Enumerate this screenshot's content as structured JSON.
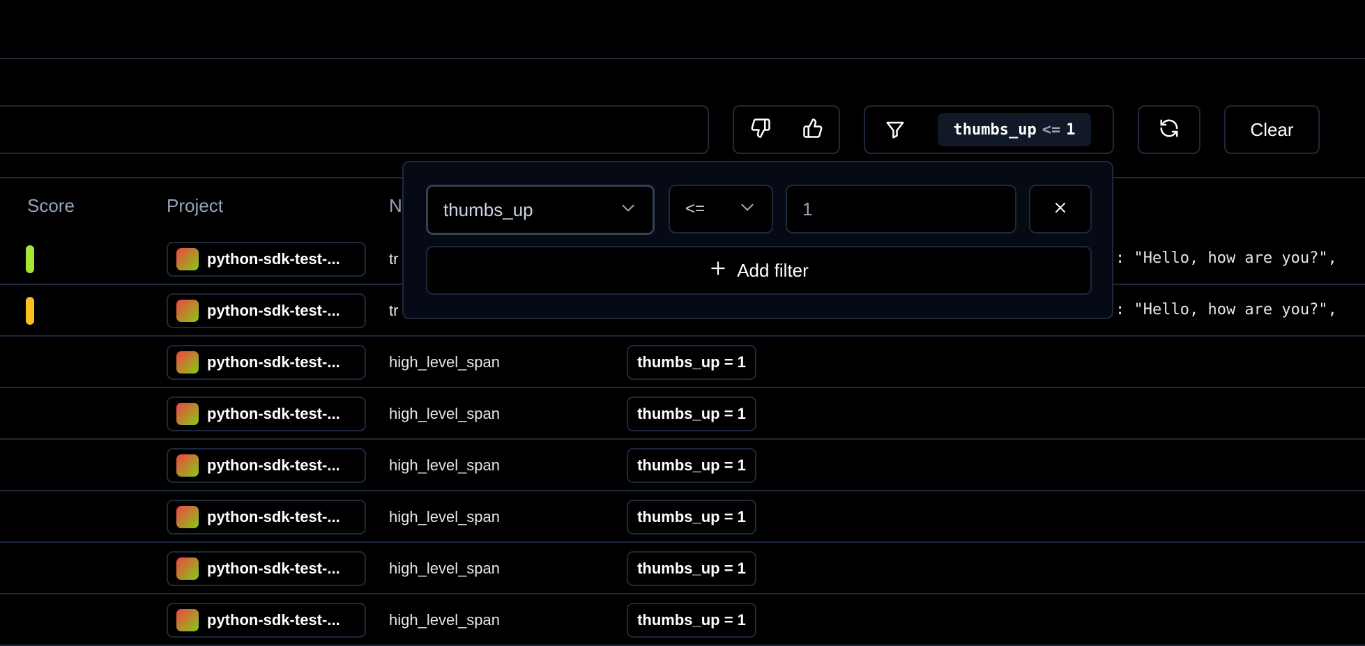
{
  "toolbar": {
    "search_value": "",
    "filter_chip": {
      "field": "thumbs_up",
      "op": "<=",
      "value": "1"
    },
    "clear_label": "Clear"
  },
  "table": {
    "headers": [
      "Score",
      "Project",
      "N"
    ],
    "rows": [
      {
        "score_color": "#a3e635",
        "project": "python-sdk-test-...",
        "name": "tr",
        "score": "",
        "input": ": \"Hello, how are you?\","
      },
      {
        "score_color": "#fbbf24",
        "project": "python-sdk-test-...",
        "name": "tr",
        "score": "",
        "input": ": \"Hello, how are you?\","
      },
      {
        "score_color": "",
        "project": "python-sdk-test-...",
        "name": "high_level_span",
        "score": "thumbs_up = 1",
        "input": ""
      },
      {
        "score_color": "",
        "project": "python-sdk-test-...",
        "name": "high_level_span",
        "score": "thumbs_up = 1",
        "input": ""
      },
      {
        "score_color": "",
        "project": "python-sdk-test-...",
        "name": "high_level_span",
        "score": "thumbs_up = 1",
        "input": ""
      },
      {
        "score_color": "",
        "project": "python-sdk-test-...",
        "name": "high_level_span",
        "score": "thumbs_up = 1",
        "input": ""
      },
      {
        "score_color": "",
        "project": "python-sdk-test-...",
        "name": "high_level_span",
        "score": "thumbs_up = 1",
        "input": ""
      },
      {
        "score_color": "",
        "project": "python-sdk-test-...",
        "name": "high_level_span",
        "score": "thumbs_up = 1",
        "input": ""
      }
    ]
  },
  "popover": {
    "field": "thumbs_up",
    "operator": "<=",
    "value": "1",
    "add_filter_label": "Add filter"
  },
  "colors": {
    "border": "#1e293b",
    "popover_bg": "#050a14",
    "chip_bg": "#111827"
  }
}
